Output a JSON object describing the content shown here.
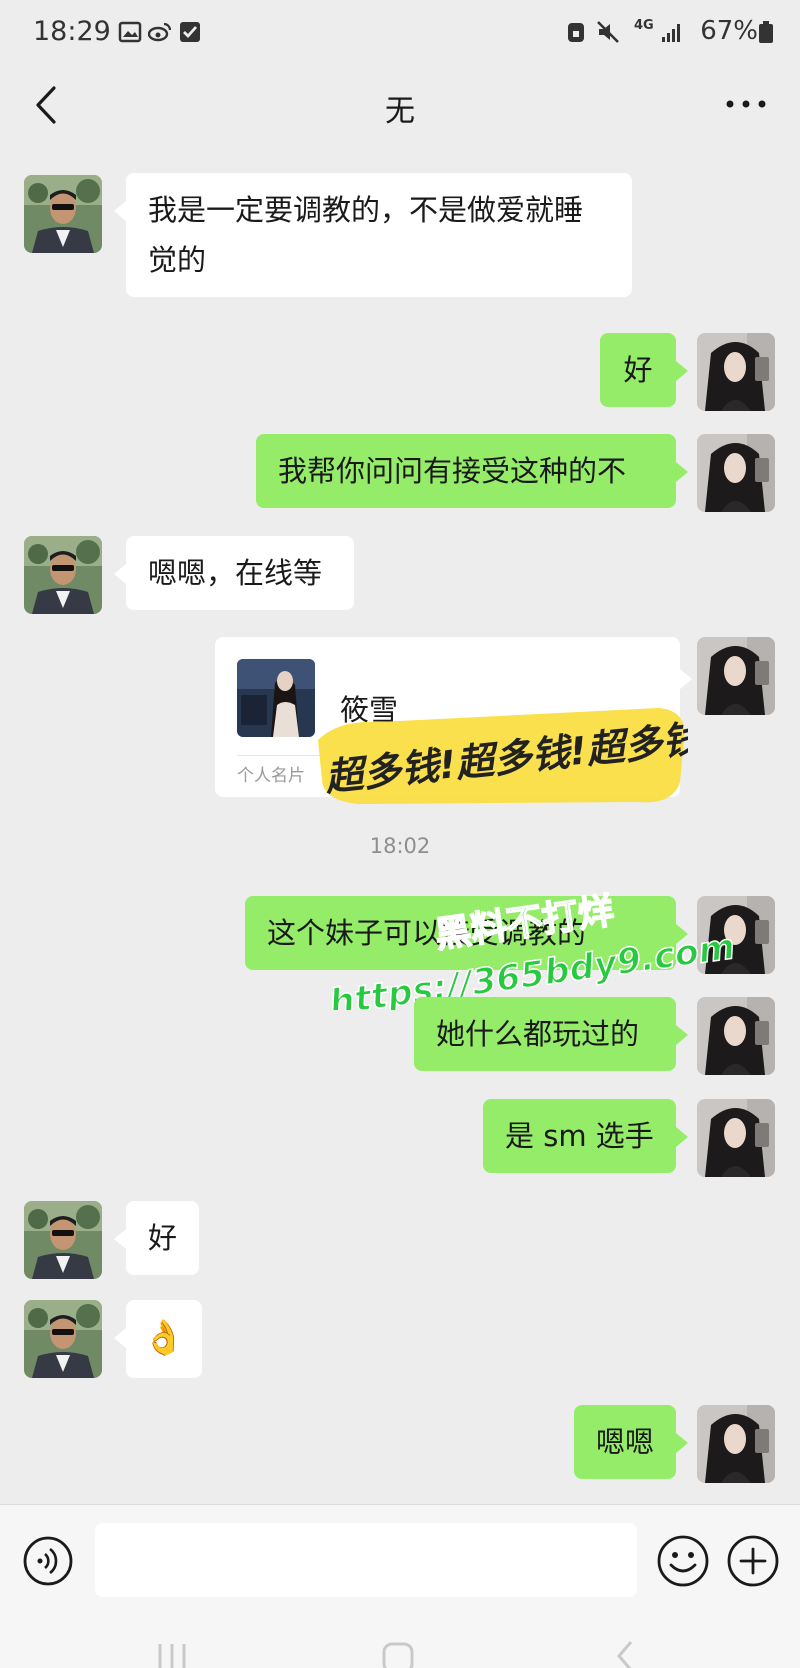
{
  "status_bar": {
    "time": "18:29",
    "battery": "67%",
    "network": "4G"
  },
  "chat": {
    "title": "无"
  },
  "messages": [
    {
      "side": "left",
      "text": "我是一定要调教的，不是做爱就睡觉的"
    },
    {
      "side": "right",
      "text": "好"
    },
    {
      "side": "right",
      "text": "我帮你问问有接受这种的不"
    },
    {
      "side": "left",
      "text": "嗯嗯，在线等"
    },
    {
      "side": "right",
      "type": "contact_card",
      "name": "筱雪",
      "card_label": "个人名片"
    },
    {
      "type": "timestamp",
      "text": "18:02"
    },
    {
      "side": "right",
      "text": "这个妹子可以接受调教的"
    },
    {
      "side": "right",
      "text": "她什么都玩过的"
    },
    {
      "side": "right",
      "text": "是 sm 选手"
    },
    {
      "side": "left",
      "text": "好"
    },
    {
      "side": "left",
      "type": "emoji",
      "emoji": "👌"
    },
    {
      "side": "right",
      "text": "嗯嗯"
    }
  ],
  "overlay": {
    "scribble_text": "超多钱!超多钱!超多钱!",
    "watermark_line1": "黑料不打烊",
    "watermark_line2": "https://365bdy9.com"
  },
  "input": {
    "placeholder": ""
  },
  "icons": {
    "back": "chevron-left-icon",
    "more": "more-dots-icon",
    "voice": "voice-icon",
    "emoji": "emoji-icon",
    "plus": "plus-icon"
  },
  "colors": {
    "right_bubble": "#95ec69",
    "left_bubble": "#ffffff",
    "background": "#ededed",
    "watermark_fill": "#27c93f"
  }
}
